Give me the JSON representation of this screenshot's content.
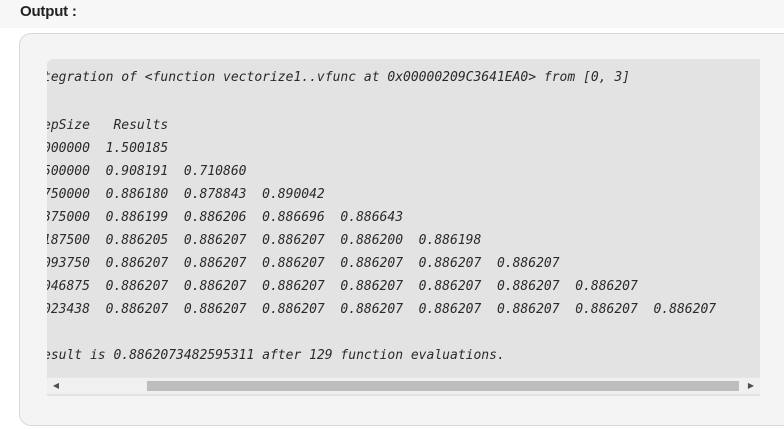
{
  "heading": "Output :",
  "output": {
    "lines": [
      "tegration of <function vectorize1..vfunc at 0x00000209C3641EA0> from [0, 3]",
      "",
      "epSize   Results",
      "000000  1.500185",
      "500000  0.908191  0.710860",
      "750000  0.886180  0.878843  0.890042",
      "375000  0.886199  0.886206  0.886696  0.886643",
      "187500  0.886205  0.886207  0.886207  0.886200  0.886198",
      "093750  0.886207  0.886207  0.886207  0.886207  0.886207  0.886207",
      "046875  0.886207  0.886207  0.886207  0.886207  0.886207  0.886207  0.886207",
      "023438  0.886207  0.886207  0.886207  0.886207  0.886207  0.886207  0.886207  0.886207",
      "",
      "esult is 0.8862073482595311 after 129 function evaluations."
    ]
  },
  "scrollbar": {
    "left_arrow": "◀",
    "right_arrow": "▶"
  }
}
